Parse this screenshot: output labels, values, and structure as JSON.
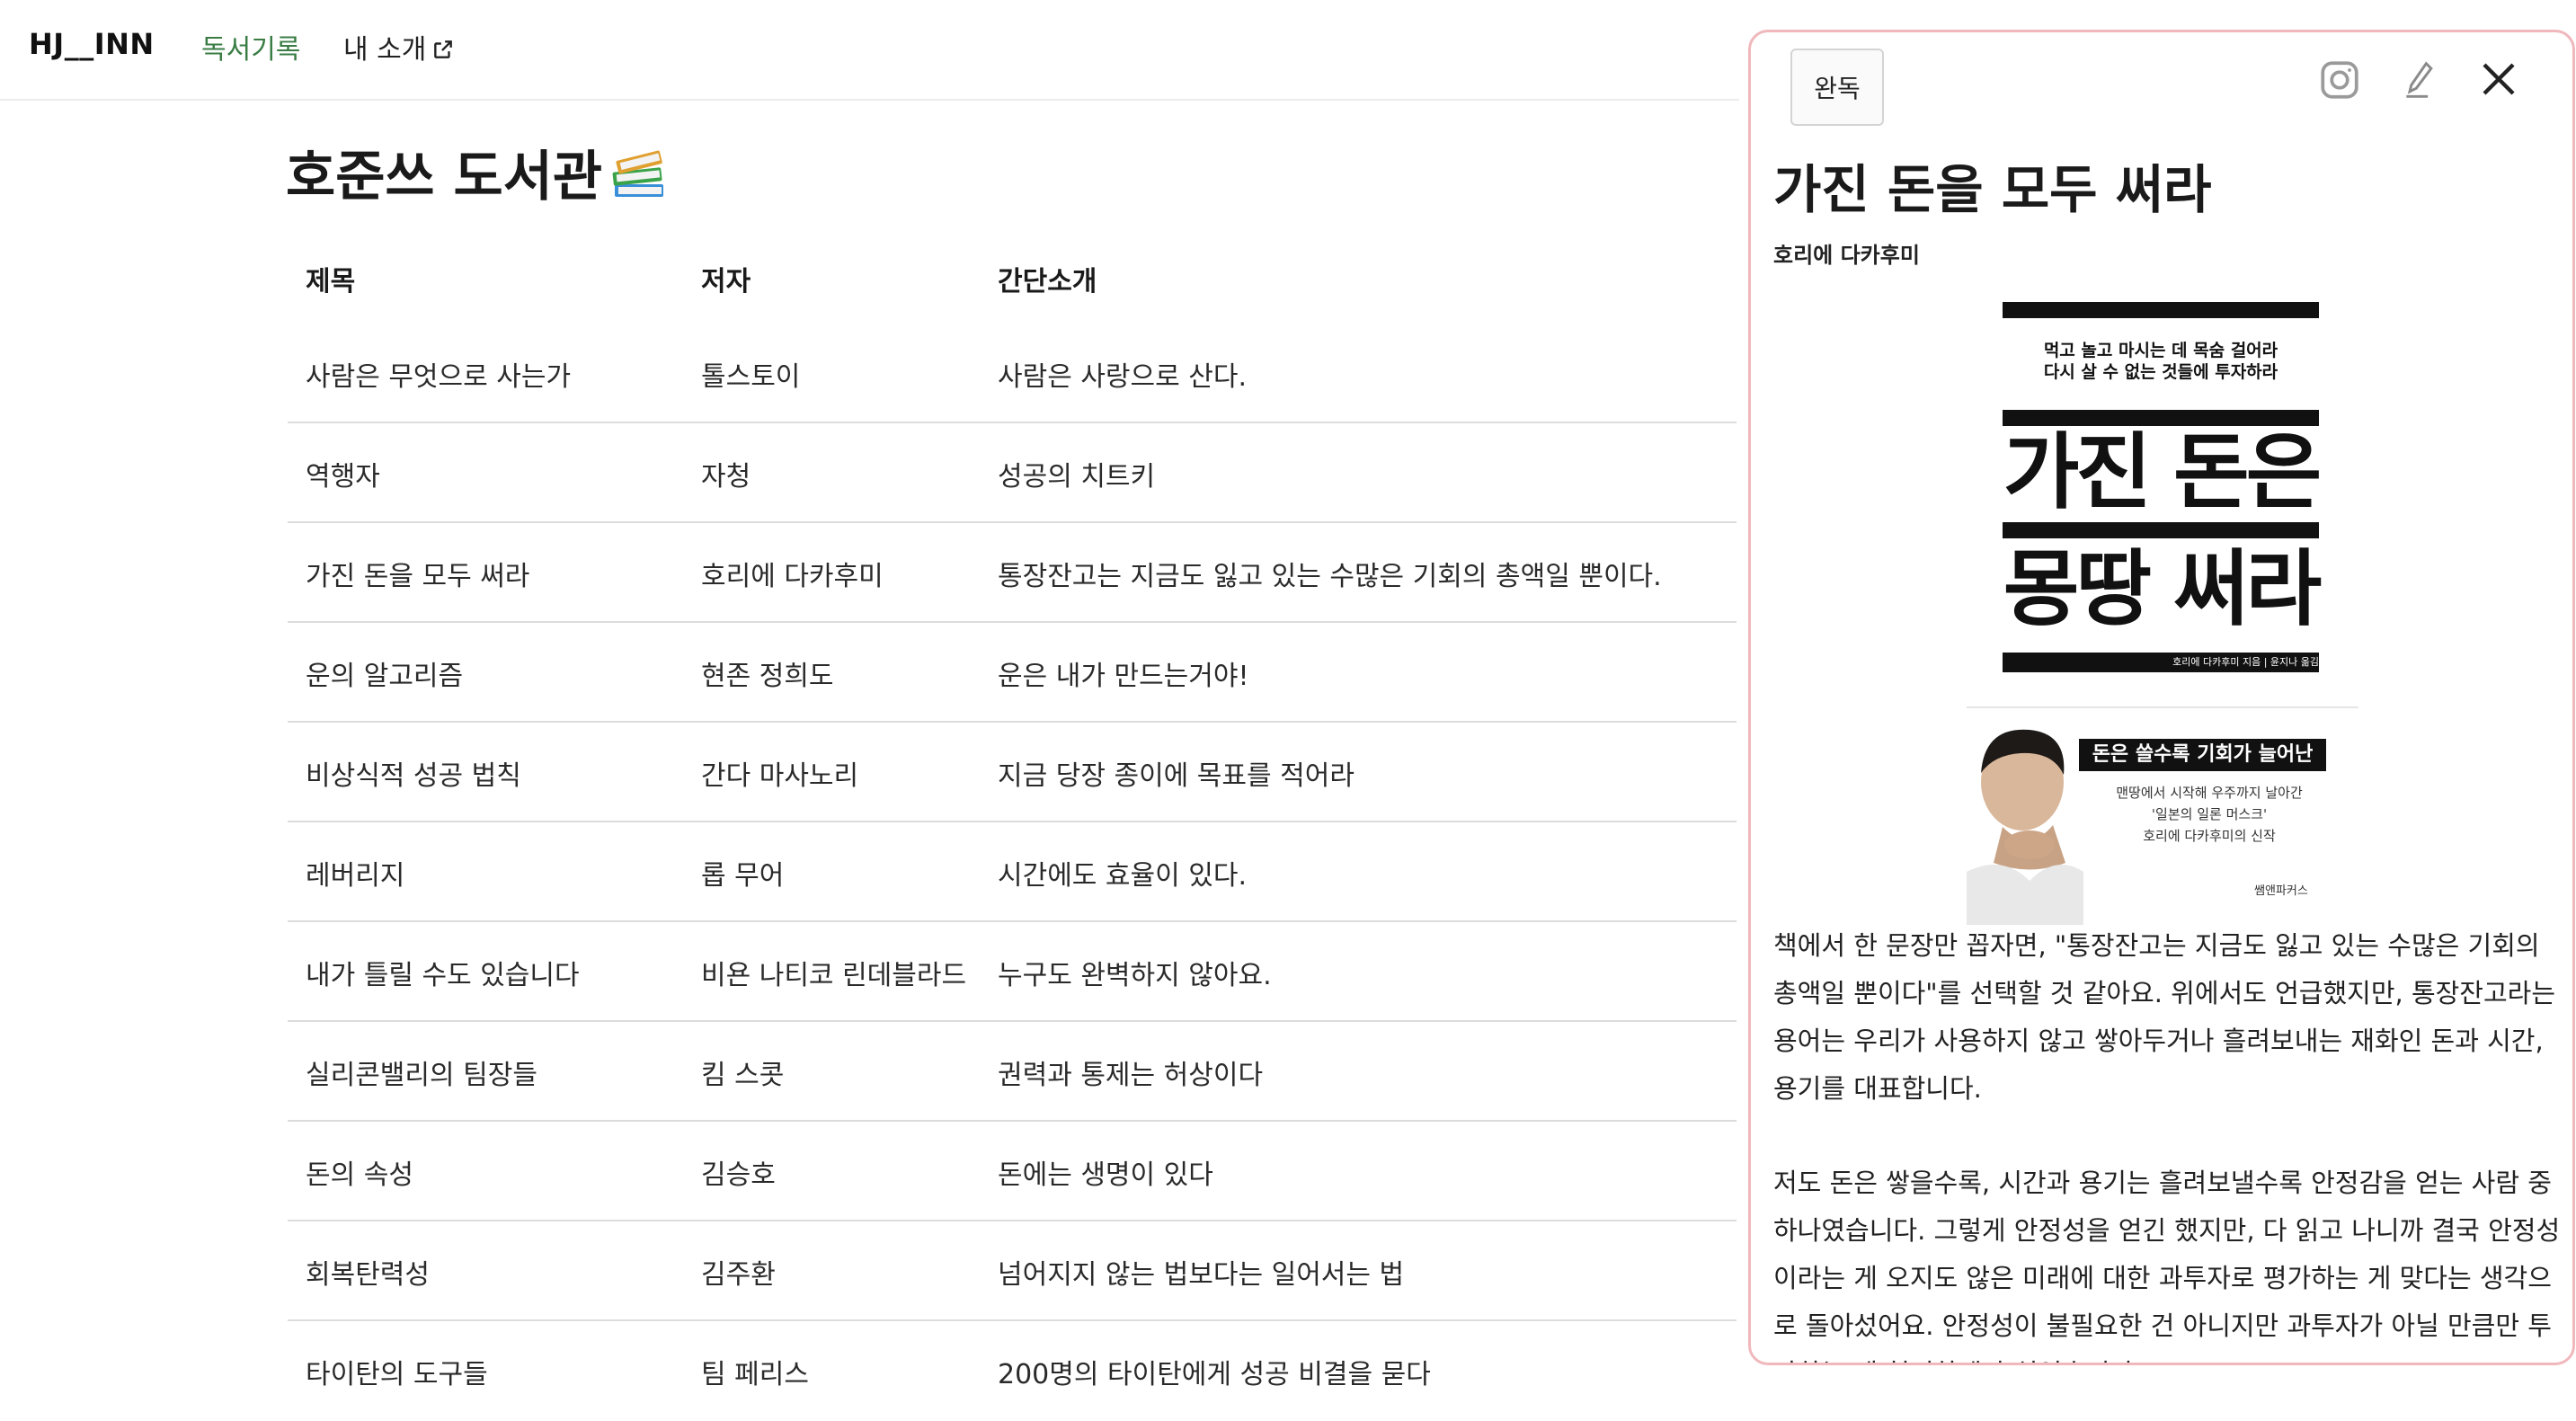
{
  "nav": {
    "brand": "HJ__INN",
    "links": [
      {
        "label": "독서기록",
        "active": true
      },
      {
        "label": "내 소개",
        "external": true
      }
    ]
  },
  "page": {
    "title": "호준쓰 도서관",
    "title_icon": "books-icon"
  },
  "table": {
    "headers": [
      "제목",
      "저자",
      "간단소개"
    ],
    "rows": [
      {
        "title": "사람은 무엇으로 사는가",
        "author": "톨스토이",
        "summary": "사람은 사랑으로 산다."
      },
      {
        "title": "역행자",
        "author": "자청",
        "summary": "성공의 치트키"
      },
      {
        "title": "가진 돈을 모두 써라",
        "author": "호리에 다카후미",
        "summary": "통장잔고는 지금도 잃고 있는 수많은 기회의 총액일 뿐이다."
      },
      {
        "title": "운의 알고리즘",
        "author": "현존 정희도",
        "summary": "운은 내가 만드는거야!"
      },
      {
        "title": "비상식적 성공 법칙",
        "author": "간다 마사노리",
        "summary": "지금 당장 종이에 목표를 적어라"
      },
      {
        "title": "레버리지",
        "author": "롭 무어",
        "summary": "시간에도 효율이 있다."
      },
      {
        "title": "내가 틀릴 수도 있습니다",
        "author": "비욘 나티코 린데블라드",
        "summary": "누구도 완벽하지 않아요."
      },
      {
        "title": "실리콘밸리의 팀장들",
        "author": "킴 스콧",
        "summary": "권력과 통제는 허상이다"
      },
      {
        "title": "돈의 속성",
        "author": "김승호",
        "summary": "돈에는 생명이 있다"
      },
      {
        "title": "회복탄력성",
        "author": "김주환",
        "summary": "넘어지지 않는 법보다는 일어서는 법"
      },
      {
        "title": "타이탄의 도구들",
        "author": "팀 페리스",
        "summary": "200명의 타이탄에게 성공 비결을 묻다"
      }
    ]
  },
  "panel": {
    "status": "완독",
    "icons": [
      "instagram-icon",
      "pen-icon",
      "close-icon"
    ],
    "title": "가진 돈을 모두 써라",
    "author": "호리에 다카후미",
    "cover": {
      "subtitle_line1": "먹고 놀고 마시는 데 목숨 걸어라",
      "subtitle_line2": "다시 살 수 없는 것들에 투자하라",
      "big_line1": "가진 돈은",
      "big_line2": "몽땅 써라",
      "credit": "호리에 다카후미 지음 | 윤지나 옮김",
      "banner": "돈은 쓸수록 기회가 늘어난다!",
      "desc_line1": "맨땅에서 시작해 우주까지 날아간",
      "desc_line2": "'일본의 일론 머스크'",
      "desc_line3": "호리에 다카후미의 신작",
      "publisher": "쌤앤파커스"
    },
    "paragraphs": [
      "책에서 한 문장만 꼽자면, \"통장잔고는 지금도 잃고 있는 수많은 기회의 총액일 뿐이다\"를 선택할 것 같아요. 위에서도 언급했지만, 통장잔고라는 용어는 우리가 사용하지 않고 쌓아두거나 흘려보내는 재화인 돈과 시간, 용기를 대표합니다.",
      "저도 돈은 쌓을수록, 시간과 용기는 흘려보낼수록 안정감을 얻는 사람 중 하나였습니다. 그렇게 안정성을 얻긴 했지만, 다 읽고 나니까 결국 안정성이라는 게 오지도 않은 미래에 대한 과투자로 평가하는 게 맞다는 생각으로 돌아섰어요. 안정성이 불필요한 건 아니지만 과투자가 아닐 만큼만 투자하는 게 현명하겠다 싶었습니다."
    ]
  },
  "colors": {
    "accent_green": "#3a7d44",
    "panel_border": "#f0b8bc",
    "row_divider": "#dcdcdc"
  }
}
